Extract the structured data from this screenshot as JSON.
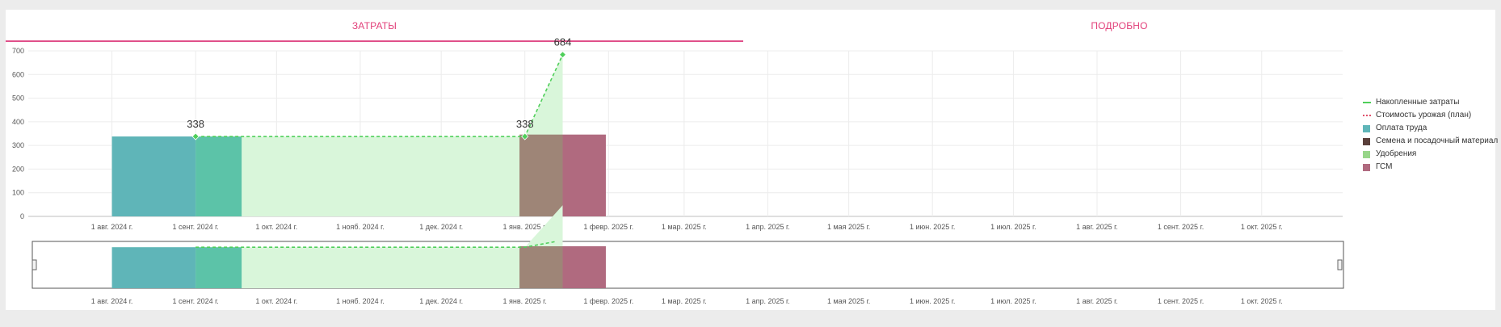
{
  "tabs": [
    {
      "label": "ЗАТРАТЫ",
      "active": true
    },
    {
      "label": "ПОДРОБНО",
      "active": false
    }
  ],
  "colors": {
    "accent": "#e2407a",
    "labor": "#5fb5b8",
    "seeds": "#5a3f3a",
    "fertilizer": "#98d68a",
    "fuel": "#b06a7f",
    "cumulative": "#4fcf5a",
    "harvest_plan": "#e0506a"
  },
  "chart_data": {
    "type": "bar",
    "x_axis": {
      "type": "time",
      "range": [
        "2024-07-01",
        "2025-10-31"
      ],
      "tick_labels": [
        "1 авг. 2024 г.",
        "1 сент. 2024 г.",
        "1 окт. 2024 г.",
        "1 нояб. 2024 г.",
        "1 дек. 2024 г.",
        "1 янв. 2025 г.",
        "1 февр. 2025 г.",
        "1 мар. 2025 г.",
        "1 апр. 2025 г.",
        "1 мая 2025 г.",
        "1 июн. 2025 г.",
        "1 июл. 2025 г.",
        "1 авг. 2025 г.",
        "1 сент. 2025 г.",
        "1 окт. 2025 г."
      ],
      "tick_dates": [
        "2024-08-01",
        "2024-09-01",
        "2024-10-01",
        "2024-11-01",
        "2024-12-01",
        "2025-01-01",
        "2025-02-01",
        "2025-03-01",
        "2025-04-01",
        "2025-05-01",
        "2025-06-01",
        "2025-07-01",
        "2025-08-01",
        "2025-09-01",
        "2025-10-01"
      ]
    },
    "y_axis": {
      "range": [
        0,
        700
      ],
      "ticks": [
        0,
        100,
        200,
        300,
        400,
        500,
        600,
        700
      ]
    },
    "grid": true,
    "legend_position": "right",
    "series": [
      {
        "name": "Накопленные затраты",
        "type": "line",
        "color_key": "cumulative",
        "points": [
          {
            "x": "2024-09-01",
            "y": 338,
            "label": "338"
          },
          {
            "x": "2025-01-01",
            "y": 338,
            "label": "338"
          },
          {
            "x": "2025-01-15",
            "y": 684,
            "label": "684"
          }
        ]
      },
      {
        "name": "Стоимость урожая (план)",
        "type": "line",
        "color_key": "harvest_plan",
        "points": []
      },
      {
        "name": "Оплата труда",
        "type": "bar",
        "color_key": "labor",
        "bars": [
          {
            "start": "2024-08-01",
            "end": "2024-09-01",
            "y": 338
          }
        ]
      },
      {
        "name": "Семена и посадочный материал",
        "type": "bar",
        "color_key": "seeds",
        "bars": []
      },
      {
        "name": "Удобрения",
        "type": "bar",
        "color_key": "fertilizer",
        "bars": []
      },
      {
        "name": "ГСМ",
        "type": "bar",
        "color_key": "fuel",
        "bars": [
          {
            "start": "2025-01-15",
            "end": "2025-01-31",
            "y": 346
          }
        ]
      }
    ],
    "navigator_ticks": [
      "1 авг. 2024 г.",
      "1 сент. 2024 г.",
      "1 окт. 2024 г.",
      "1 нояб. 2024 г.",
      "1 дек. 2024 г.",
      "1 янв. 2025 г.",
      "1 февр. 2025 г.",
      "1 мар. 2025 г.",
      "1 апр. 2025 г.",
      "1 мая 2025 г.",
      "1 июн. 2025 г.",
      "1 июл. 2025 г.",
      "1 авг. 2025 г.",
      "1 сент. 2025 г.",
      "1 окт. 2025 г."
    ]
  }
}
